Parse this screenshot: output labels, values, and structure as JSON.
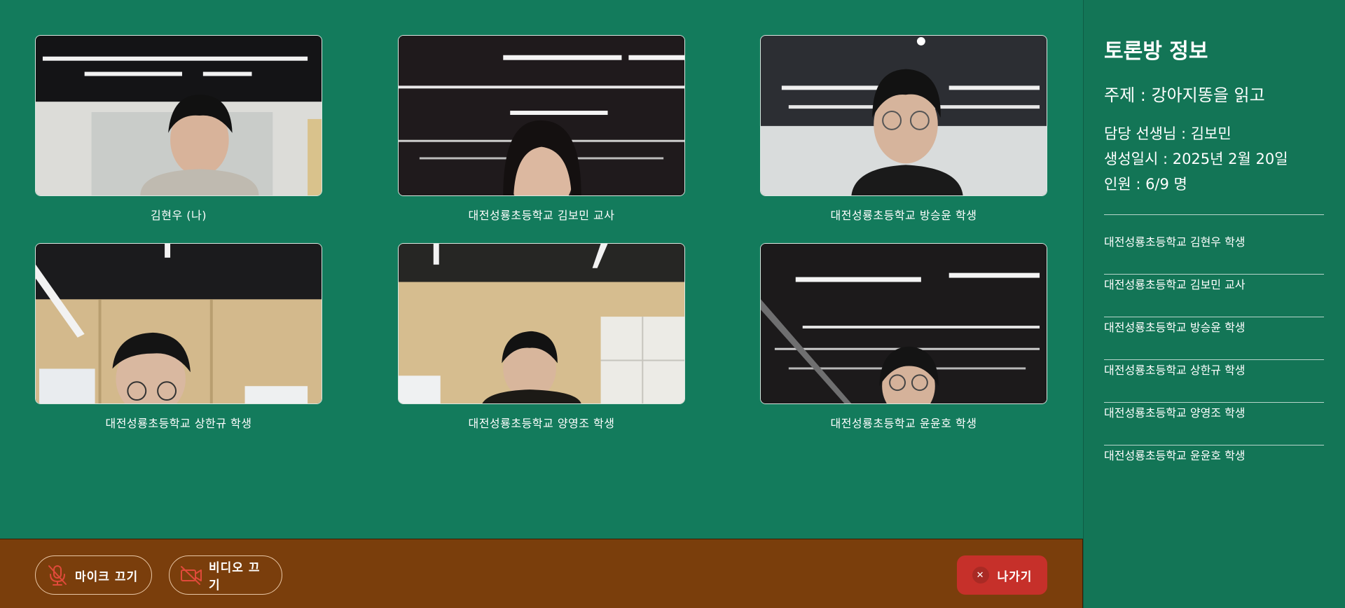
{
  "tiles": [
    {
      "name": "김현우 (나)",
      "scene": "classroom"
    },
    {
      "name": "대전성룡초등학교 김보민 교사",
      "scene": "office"
    },
    {
      "name": "대전성룡초등학교 방승윤 학생",
      "scene": "office"
    },
    {
      "name": "대전성룡초등학교 상한규 학생",
      "scene": "wood-wall"
    },
    {
      "name": "대전성룡초등학교 양영조 학생",
      "scene": "wood-wall"
    },
    {
      "name": "대전성룡초등학교 윤윤호 학생",
      "scene": "office"
    }
  ],
  "controls": {
    "mic_label": "마이크 끄기",
    "mic_icon": "mic-off-icon",
    "video_label": "비디오 끄기",
    "video_icon": "camera-off-icon",
    "leave_label": "나가기",
    "leave_icon": "x-icon"
  },
  "side_panel": {
    "title": "토론방 정보",
    "topic": "주제 : 강아지똥을 읽고",
    "teacher": "담당 선생님 : 김보민",
    "created": "생성일시 : 2025년 2월 20일",
    "members": "인원 : 6/9 명",
    "participants": [
      "대전성룡초등학교 김현우 학생",
      "대전성룡초등학교 김보민 교사",
      "대전성룡초등학교 방승윤 학생",
      "대전성룡초등학교 상한규 학생",
      "대전성룡초등학교 양영조 학생",
      "대전성룡초등학교 윤윤호 학생"
    ]
  },
  "colors": {
    "background": "#137b5c",
    "control_bar": "#7a3e0c",
    "leave_button": "#c6302a"
  }
}
